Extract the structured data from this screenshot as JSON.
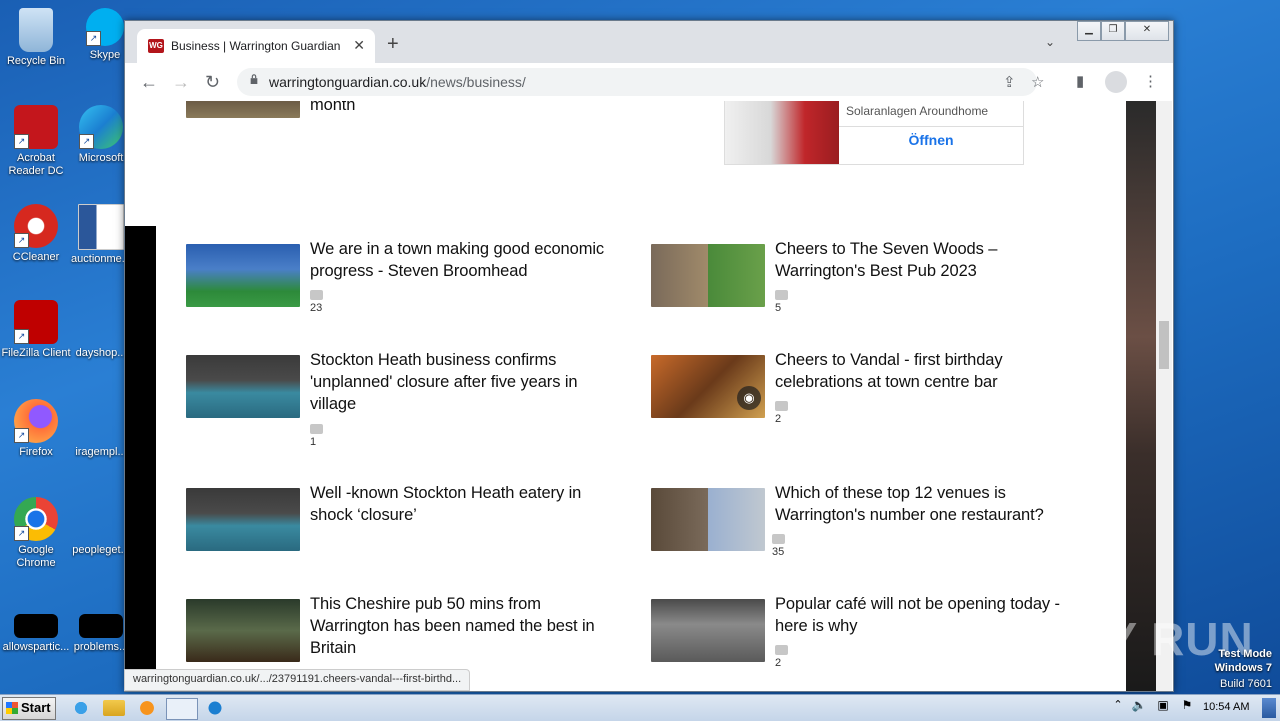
{
  "desktop": {
    "icons": [
      {
        "label": "Recycle Bin"
      },
      {
        "label": "Skype"
      },
      {
        "label": "Acrobat Reader DC"
      },
      {
        "label": "Microsoft"
      },
      {
        "label": "CCleaner"
      },
      {
        "label": "auctionme..."
      },
      {
        "label": "FileZilla Client"
      },
      {
        "label": "dayshop..."
      },
      {
        "label": "Firefox"
      },
      {
        "label": "iragempl..."
      },
      {
        "label": "Google Chrome"
      },
      {
        "label": "peopleget..."
      },
      {
        "label": "allowspartic..."
      },
      {
        "label": "problems..."
      }
    ]
  },
  "browser": {
    "tab_title": "Business | Warrington Guardian",
    "tab_favicon_text": "WG",
    "url_host": "warringtonguardian.co.uk",
    "url_path": "/news/business/",
    "status_url": "warringtonguardian.co.uk/.../23791191.cheers-vandal---first-birthd..."
  },
  "page": {
    "top_fragment": "month",
    "ad": {
      "text": "Solaranlagen Aroundhome",
      "button": "Öffnen"
    },
    "articles": [
      {
        "title": "We are in a town making good economic progress - Steven Broomhead",
        "comments": "23"
      },
      {
        "title": "Cheers to The Seven Woods – Warrington's Best Pub 2023",
        "comments": "5"
      },
      {
        "title": "Stockton Heath business confirms 'unplanned' closure after five years in village",
        "comments": "1"
      },
      {
        "title": "Cheers to Vandal - first birthday celebrations at town centre bar",
        "comments": "2"
      },
      {
        "title": "Well -known Stockton Heath eatery in shock ‘closure’",
        "comments": ""
      },
      {
        "title": "Which of these top 12 venues is Warrington's number one restaurant?",
        "comments": "35"
      },
      {
        "title": "This Cheshire pub 50 mins from Warrington has been named the best in Britain",
        "comments": ""
      },
      {
        "title": "Popular café will not be opening today - here is why",
        "comments": "2"
      }
    ]
  },
  "taskbar": {
    "start": "Start",
    "clock": "10:54 AM"
  },
  "watermark": {
    "brand": "ANY RUN",
    "line1": "Test Mode",
    "line2": "Windows 7",
    "line3": "Build 7601"
  }
}
